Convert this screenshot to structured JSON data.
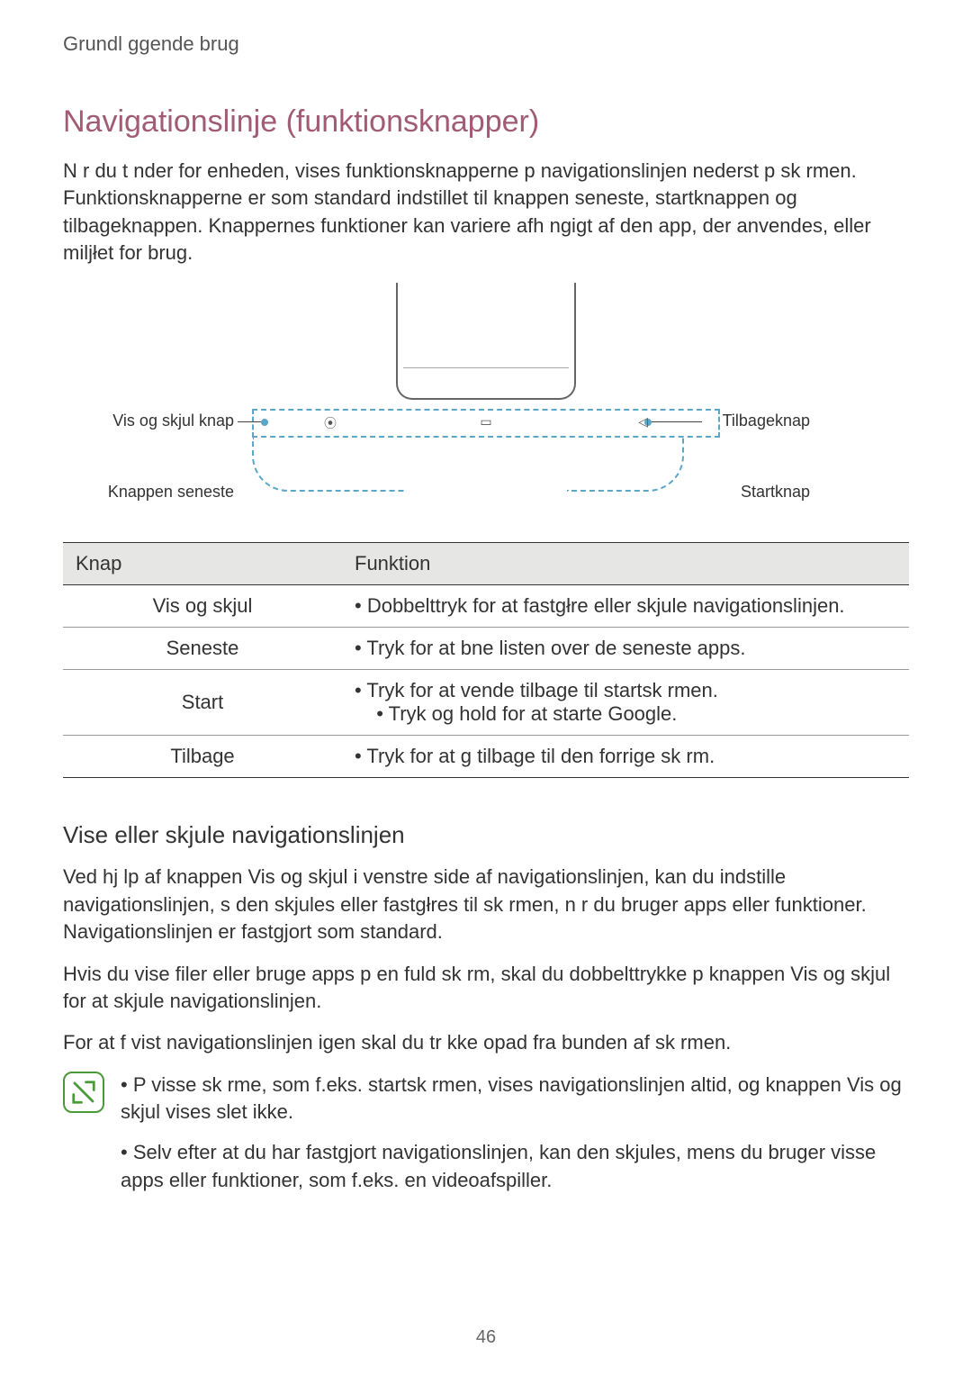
{
  "chapter": "Grundl ggende brug",
  "heading": "Navigationslinje (funktionsknapper)",
  "intro": "N r du t nder for enheden, vises funktionsknapperne p  navigationslinjen nederst p  sk rmen. Funktionsknapperne er som standard indstillet til knappen seneste, startknappen og tilbageknappen. Knappernes funktioner kan variere afh ngigt af den app, der anvendes, eller miljłet for brug.",
  "callouts": {
    "show_hide": "Vis og skjul knap",
    "recent": "Knappen seneste",
    "back": "Tilbageknap",
    "home": "Startknap"
  },
  "table": {
    "head": {
      "c1": "Knap",
      "c2": "Funktion"
    },
    "rows": [
      {
        "key": "Vis og skjul",
        "fn": "Dobbelttryk for at fastgłre eller skjule navigationslinjen."
      },
      {
        "key": "Seneste",
        "fn": "Tryk for at  bne listen over de seneste apps."
      },
      {
        "key": "Start",
        "fn": "Tryk for at vende tilbage til startsk rmen.",
        "fn2": "Tryk og hold for at starte Google."
      },
      {
        "key": "Tilbage",
        "fn": "Tryk for at g  tilbage til den forrige sk rm."
      }
    ]
  },
  "sub_heading": "Vise eller skjule navigationslinjen",
  "body": {
    "p1": "Ved hj lp af knappen Vis og skjul i venstre side af navigationslinjen, kan du indstille navigationslinjen, s  den skjules eller fastgłres til sk rmen, n r du bruger apps eller funktioner. Navigationslinjen er fastgjort som standard.",
    "p2": "Hvis du vise filer eller bruge apps p  en fuld sk rm, skal du dobbelttrykke p  knappen Vis og skjul for at skjule navigationslinjen.",
    "p3": "For at f  vist navigationslinjen igen skal du tr kke opad fra bunden af sk rmen."
  },
  "note": {
    "n1": "P  visse sk rme, som f.eks. startsk rmen, vises navigationslinjen altid, og knappen Vis og skjul vises slet ikke.",
    "n2": "Selv efter at du har fastgjort navigationslinjen, kan den skjules, mens du bruger visse apps eller funktioner, som f.eks. en videoafspiller."
  },
  "page": "46"
}
